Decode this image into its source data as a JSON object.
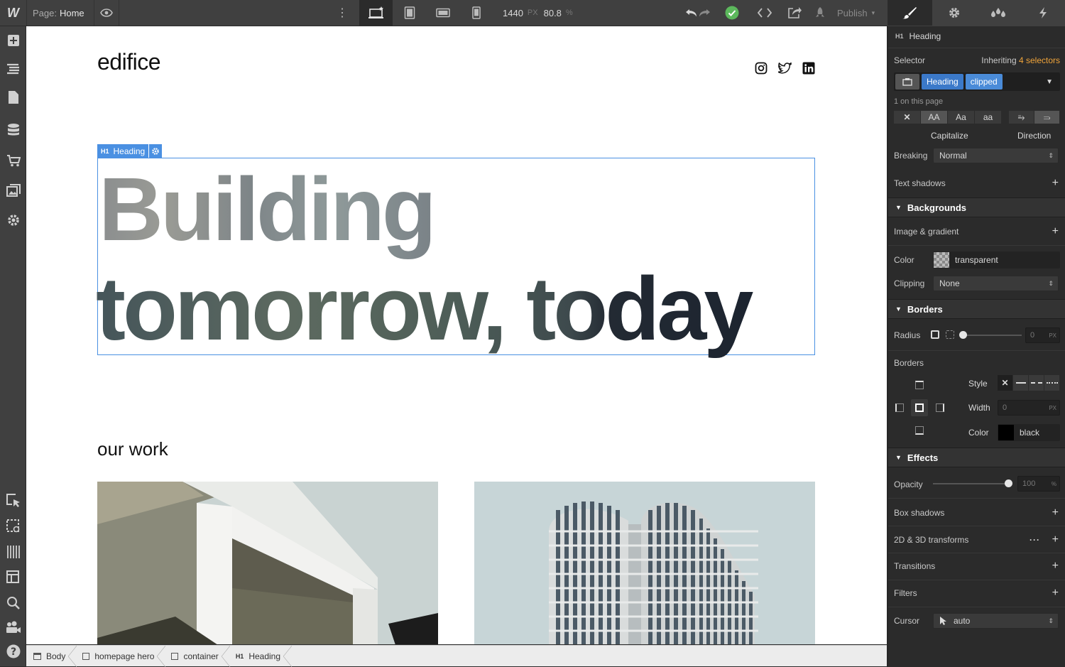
{
  "topbar": {
    "logo": "W",
    "page_label": "Page:",
    "page_name": "Home",
    "width_value": "1440",
    "width_unit": "PX",
    "zoom_value": "80.8",
    "zoom_unit": "%",
    "publish_label": "Publish"
  },
  "canvas": {
    "logo_text": "edifice",
    "heading_badge_label": "Heading",
    "hero_line1": "Building",
    "hero_line2": "tomorrow, today",
    "section_title": "our work"
  },
  "breadcrumbs": [
    {
      "label": "Body"
    },
    {
      "label": "homepage hero"
    },
    {
      "label": "container"
    },
    {
      "label": "Heading"
    }
  ],
  "panel": {
    "element_tag": "H1",
    "element_name": "Heading",
    "selector_label": "Selector",
    "inheriting_label": "Inheriting",
    "inheriting_count": "4 selectors",
    "selector_tags": [
      "Heading",
      "clipped"
    ],
    "on_page": "1 on this page",
    "capitalize_label": "Capitalize",
    "direction_label": "Direction",
    "breaking_label": "Breaking",
    "breaking_value": "Normal",
    "text_shadows_label": "Text shadows",
    "backgrounds": {
      "title": "Backgrounds",
      "image_gradient_label": "Image & gradient",
      "color_label": "Color",
      "color_value": "transparent",
      "clipping_label": "Clipping",
      "clipping_value": "None"
    },
    "borders": {
      "title": "Borders",
      "radius_label": "Radius",
      "radius_value": "0",
      "radius_unit": "PX",
      "borders_label": "Borders",
      "style_label": "Style",
      "width_label": "Width",
      "width_value": "0",
      "width_unit": "PX",
      "color_label": "Color",
      "color_value": "black"
    },
    "effects": {
      "title": "Effects",
      "opacity_label": "Opacity",
      "opacity_value": "100",
      "opacity_unit": "%",
      "box_shadows_label": "Box shadows",
      "transforms_label": "2D & 3D transforms",
      "transitions_label": "Transitions",
      "filters_label": "Filters",
      "cursor_label": "Cursor",
      "cursor_value": "auto"
    }
  },
  "colors": {
    "accent": "#4a90e2",
    "selector_tag_heading": "#3b79c9",
    "selector_tag_clipped": "#4a8bd8",
    "success": "#5cb85c",
    "inherit_highlight": "#f0a43a"
  }
}
